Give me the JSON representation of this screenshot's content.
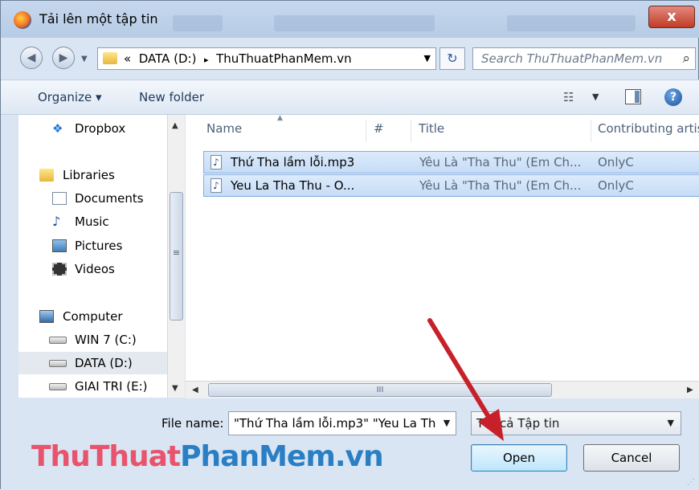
{
  "window": {
    "title": "Tải lên một tập tin",
    "close_label": "x"
  },
  "address_bar": {
    "prefix": "«",
    "path": [
      "DATA (D:)",
      "ThuThuatPhanMem.vn"
    ],
    "separator": "▸",
    "search_placeholder": "Search ThuThuatPhanMem.vn"
  },
  "toolbar": {
    "organize_label": "Organize ▾",
    "new_folder_label": "New folder"
  },
  "nav": {
    "items": [
      {
        "label": "Dropbox",
        "icon": "dropbox-icon"
      },
      {
        "label": "Libraries",
        "icon": "libraries-icon"
      },
      {
        "label": "Documents",
        "icon": "documents-icon"
      },
      {
        "label": "Music",
        "icon": "music-icon"
      },
      {
        "label": "Pictures",
        "icon": "pictures-icon"
      },
      {
        "label": "Videos",
        "icon": "videos-icon"
      },
      {
        "label": "Computer",
        "icon": "computer-icon"
      },
      {
        "label": "WIN 7 (C:)",
        "icon": "drive-icon"
      },
      {
        "label": "DATA (D:)",
        "icon": "drive-icon"
      },
      {
        "label": "GIAI TRI (E:)",
        "icon": "drive-icon"
      }
    ]
  },
  "file_list": {
    "columns": [
      "Name",
      "#",
      "Title",
      "Contributing artis"
    ],
    "rows": [
      {
        "name": "Thứ Tha lầm lỗi.mp3",
        "number": "",
        "title": "Yêu Là \"Tha Thu\" (Em Ch...",
        "artist": "OnlyC"
      },
      {
        "name": "Yeu La Tha Thu - O...",
        "number": "",
        "title": "Yêu Là \"Tha Thu\" (Em Ch...",
        "artist": "OnlyC"
      }
    ]
  },
  "hscroll_grip": "III",
  "vscroll_grip": "≡",
  "bottom": {
    "file_name_label": "File name:",
    "file_name_value": "\"Thứ Tha lầm lỗi.mp3\" \"Yeu La Th",
    "file_type_value": "Tất cả Tập tin",
    "open_label": "Open",
    "cancel_label": "Cancel"
  },
  "watermark": {
    "part1": "ThuThuat",
    "part2": "PhanMem.vn"
  },
  "colors": {
    "accent_arrow": "#c8202a",
    "watermark_pink": "#e8546e",
    "watermark_blue": "#2a7fc4"
  }
}
